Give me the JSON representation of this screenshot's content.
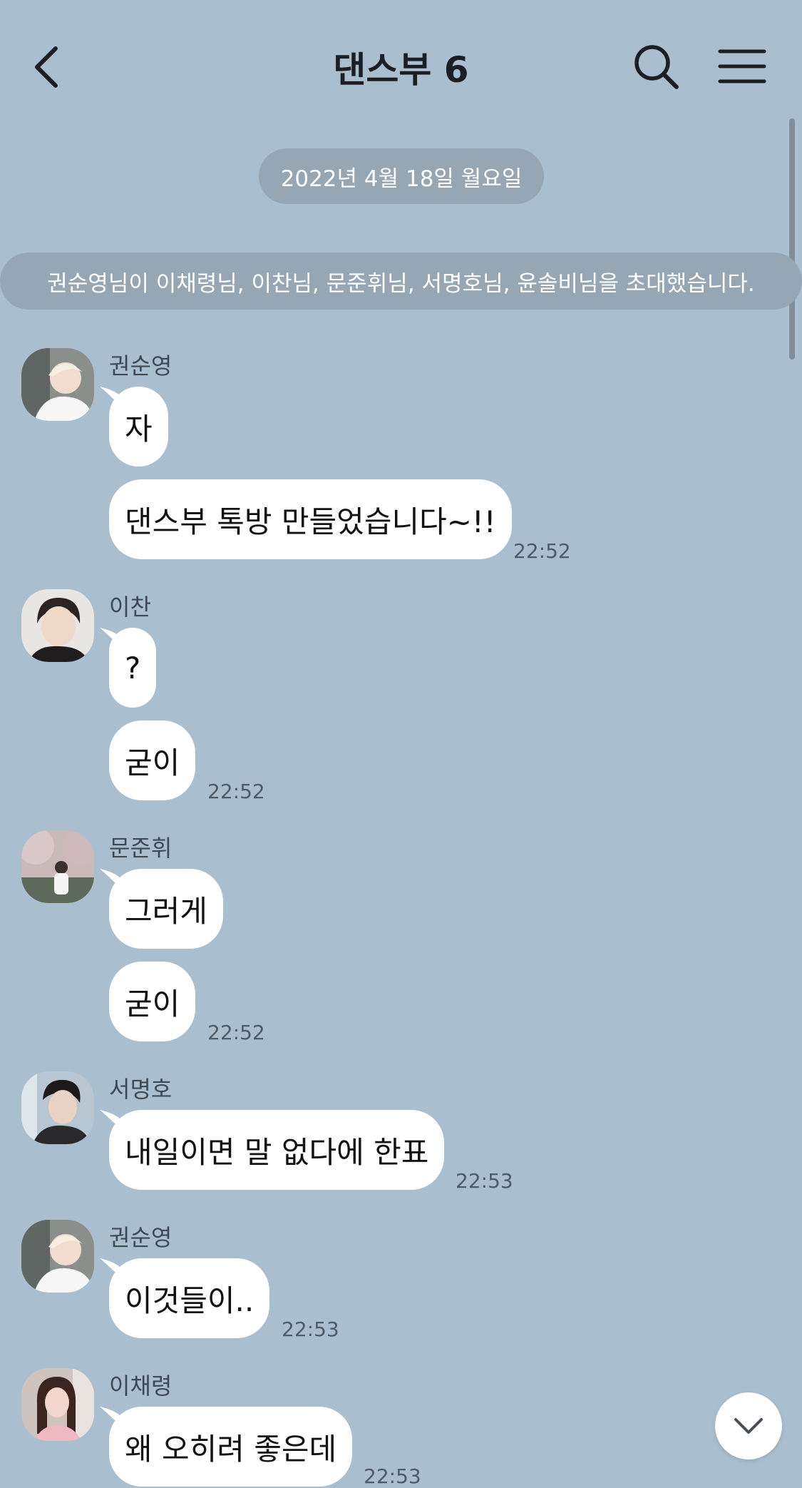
{
  "header": {
    "title": "댄스부 6"
  },
  "date_divider": "2022년 4월 18일 월요일",
  "system_notice": "권순영님이 이채령님, 이찬님, 문준휘님, 서명호님, 윤솔비님을 초대했습니다.",
  "messages": [
    {
      "sender": "권순영",
      "texts": [
        "자",
        "댄스부 톡방 만들었습니다~!!"
      ],
      "time": "22:52"
    },
    {
      "sender": "이찬",
      "texts": [
        "?",
        "굳이"
      ],
      "time": "22:52"
    },
    {
      "sender": "문준휘",
      "texts": [
        "그러게",
        "굳이"
      ],
      "time": "22:52"
    },
    {
      "sender": "서명호",
      "texts": [
        "내일이면 말 없다에 한표"
      ],
      "time": "22:53"
    },
    {
      "sender": "권순영",
      "texts": [
        "이것들이.."
      ],
      "time": "22:53"
    },
    {
      "sender": "이채령",
      "texts": [
        "왜 오히려 좋은데"
      ],
      "time": "22:53"
    }
  ]
}
